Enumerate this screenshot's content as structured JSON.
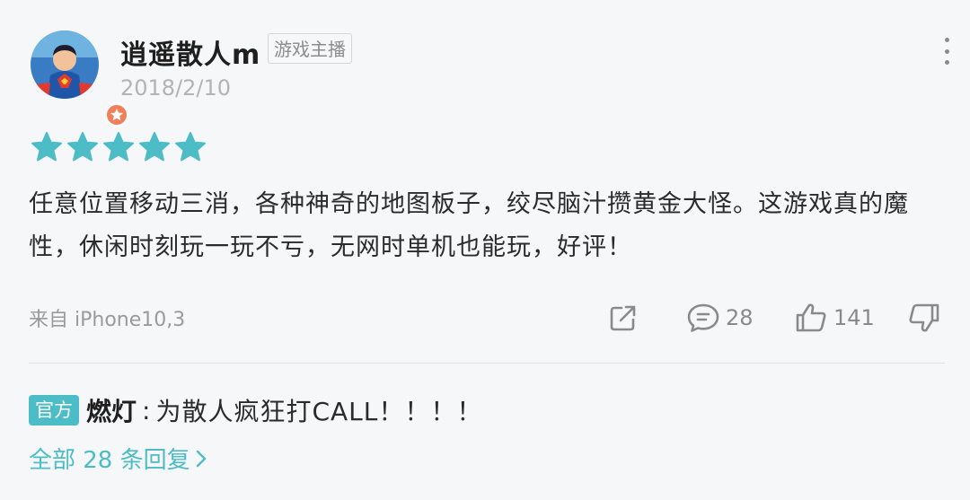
{
  "author": {
    "name": "逍遥散人m",
    "role_badge": "游戏主播",
    "date": "2018/2/10"
  },
  "rating": {
    "stars": 5,
    "max_stars": 5,
    "color": "#4cbcc7"
  },
  "review": {
    "text": "任意位置移动三消，各种神奇的地图板子，绞尽脑汁攒黄金大怪。这游戏真的魔性，休闲时刻玩一玩不亏，无网时单机也能玩，好评！"
  },
  "device": "来自 iPhone10,3",
  "actions": {
    "comment_count": "28",
    "like_count": "141"
  },
  "official_reply": {
    "badge": "官方",
    "author": "燃灯",
    "separator": ":",
    "text": "为散人疯狂打CALL！！！！"
  },
  "all_replies_link": "全部 28 条回复",
  "colors": {
    "accent": "#4cbcc7",
    "verified_badge": "#f07f5a",
    "background": "#f6f7f9"
  },
  "icons": {
    "more": "vertical-dots-icon",
    "share": "share-icon",
    "comment": "comment-icon",
    "like": "thumbs-up-icon",
    "dislike": "thumbs-down-icon",
    "chevron": "chevron-right-icon"
  }
}
